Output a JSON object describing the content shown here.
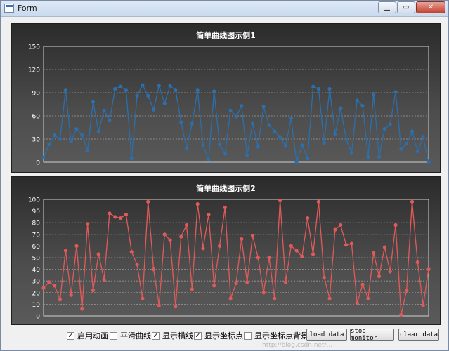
{
  "window": {
    "title": "Form"
  },
  "controls": {
    "checkboxes": [
      {
        "label": "启用动画",
        "checked": true
      },
      {
        "label": "平滑曲线",
        "checked": false
      },
      {
        "label": "显示横线",
        "checked": true
      },
      {
        "label": "显示坐标点",
        "checked": true
      },
      {
        "label": "显示坐标点背景",
        "checked": false
      }
    ],
    "buttons": {
      "load": "load data",
      "stop": "stop monitor",
      "clear": "claar data"
    }
  },
  "watermark": "http://blog.csdn.net/...",
  "chart_data": [
    {
      "type": "line",
      "title": "简单曲线图示例1",
      "ylim": [
        0,
        150
      ],
      "yticks": [
        0,
        30,
        60,
        90,
        120,
        150
      ],
      "color": "#2b6fac",
      "grid": true,
      "values": [
        6,
        23,
        35,
        30,
        93,
        27,
        43,
        35,
        15,
        78,
        40,
        67,
        54,
        95,
        98,
        93,
        5,
        86,
        100,
        86,
        68,
        99,
        76,
        99,
        93,
        52,
        18,
        50,
        93,
        22,
        3,
        92,
        23,
        11,
        67,
        59,
        73,
        9,
        50,
        20,
        72,
        48,
        40,
        32,
        21,
        57,
        0,
        22,
        5,
        98,
        95,
        25,
        95,
        36,
        70,
        30,
        12,
        80,
        73,
        7,
        87,
        7,
        43,
        49,
        91,
        17,
        24,
        40,
        14,
        32,
        0
      ]
    },
    {
      "type": "line",
      "title": "简单曲线图示例2",
      "ylim": [
        0,
        100
      ],
      "yticks": [
        0,
        10,
        20,
        30,
        40,
        50,
        60,
        70,
        80,
        90,
        100
      ],
      "color": "#e05a5a",
      "grid": true,
      "values": [
        24,
        29,
        26,
        14,
        56,
        18,
        60,
        6,
        79,
        22,
        53,
        31,
        88,
        85,
        84,
        87,
        55,
        44,
        15,
        98,
        40,
        9,
        70,
        65,
        8,
        68,
        78,
        23,
        96,
        58,
        87,
        26,
        60,
        93,
        15,
        28,
        66,
        29,
        69,
        50,
        20,
        50,
        15,
        99,
        29,
        60,
        56,
        51,
        84,
        53,
        98,
        33,
        15,
        74,
        78,
        61,
        62,
        11,
        27,
        15,
        54,
        34,
        59,
        38,
        78,
        1,
        22,
        98,
        46,
        9,
        40
      ]
    }
  ]
}
